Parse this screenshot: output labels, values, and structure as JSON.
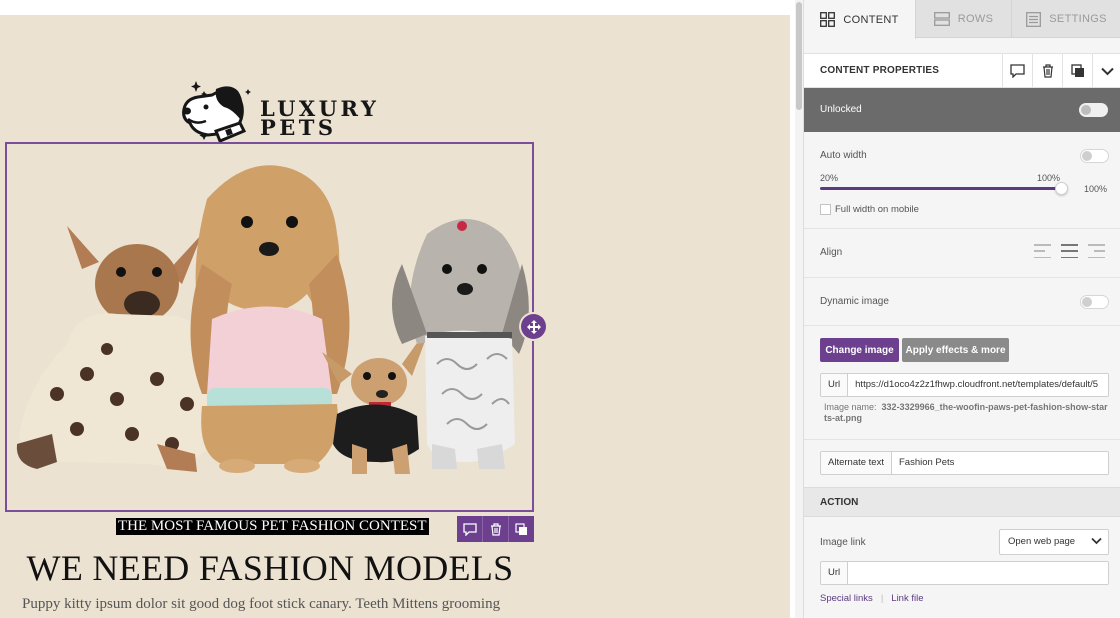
{
  "canvas": {
    "logo": {
      "line1": "LUXURY",
      "line2": "PETS"
    },
    "contest_title": "THE MOST FAMOUS PET FASHION CONTEST",
    "headline": "WE NEED FASHION MODELS",
    "body_text": "Puppy kitty ipsum dolor sit good dog foot stick canary. Teeth Mittens grooming",
    "block_toolbar": [
      "comment-icon",
      "trash-icon",
      "duplicate-icon"
    ],
    "accent_color": "#6d3f8f",
    "background_color": "#ebe2d1"
  },
  "sidebar": {
    "tabs": [
      {
        "label": "CONTENT",
        "icon": "grid-icon",
        "active": true
      },
      {
        "label": "ROWS",
        "icon": "rows-icon",
        "active": false
      },
      {
        "label": "SETTINGS",
        "icon": "settings-list-icon",
        "active": false
      }
    ],
    "properties": {
      "title": "CONTENT PROPERTIES",
      "actions": [
        "comment-icon",
        "trash-icon",
        "duplicate-icon",
        "chevron-down-icon"
      ]
    },
    "lock": {
      "label": "Unlocked",
      "enabled": false
    },
    "auto_width": {
      "label": "Auto width",
      "enabled": false
    },
    "width_slider": {
      "min_label": "20%",
      "max_label": "100%",
      "value_label": "100%",
      "value": 100
    },
    "full_width_mobile": {
      "label": "Full width on mobile",
      "checked": false
    },
    "align": {
      "label": "Align",
      "options": [
        "left",
        "center",
        "right"
      ],
      "selected": "center"
    },
    "dynamic_image": {
      "label": "Dynamic image",
      "enabled": false
    },
    "buttons": {
      "change_image": "Change image",
      "apply_effects": "Apply effects & more"
    },
    "url": {
      "label": "Url",
      "value": "https://d1oco4z2z1fhwp.cloudfront.net/templates/default/5"
    },
    "image_name": {
      "label": "Image name:",
      "value": "332-3329966_the-woofin-paws-pet-fashion-show-starts-at.png"
    },
    "alternate_text": {
      "label": "Alternate text",
      "value": "Fashion Pets"
    },
    "action": {
      "section_title": "ACTION",
      "image_link_label": "Image link",
      "image_link_value": "Open web page",
      "url_label": "Url",
      "url_value": "",
      "special_links": "Special links",
      "link_file": "Link file"
    },
    "colors": {
      "primary": "#6d3f8f",
      "lock_bar": "#6b6b6b",
      "link": "#5b3a83"
    }
  }
}
